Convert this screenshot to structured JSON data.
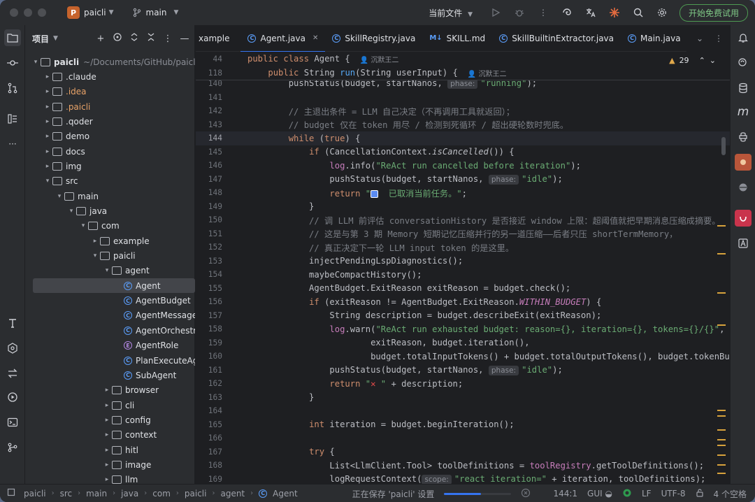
{
  "window": {
    "project_badge": "P",
    "project_name": "paicli",
    "branch": "main",
    "run_config": "当前文件",
    "trial_button": "开始免费试用"
  },
  "project_panel": {
    "title": "项目",
    "tree": [
      {
        "depth": 0,
        "arrow": "open",
        "icon": "folder",
        "name": "paicli",
        "path": "~/Documents/GitHub/paicli",
        "style": "bold"
      },
      {
        "depth": 1,
        "arrow": "closed",
        "icon": "folder",
        "name": ".claude"
      },
      {
        "depth": 1,
        "arrow": "closed",
        "icon": "folder",
        "name": ".idea",
        "style": "orange"
      },
      {
        "depth": 1,
        "arrow": "closed",
        "icon": "folder",
        "name": ".paicli",
        "style": "orange"
      },
      {
        "depth": 1,
        "arrow": "closed",
        "icon": "folder",
        "name": ".qoder"
      },
      {
        "depth": 1,
        "arrow": "closed",
        "icon": "folder",
        "name": "demo"
      },
      {
        "depth": 1,
        "arrow": "closed",
        "icon": "folder",
        "name": "docs"
      },
      {
        "depth": 1,
        "arrow": "closed",
        "icon": "folder",
        "name": "img"
      },
      {
        "depth": 1,
        "arrow": "open",
        "icon": "folder",
        "name": "src"
      },
      {
        "depth": 2,
        "arrow": "open",
        "icon": "folder",
        "name": "main"
      },
      {
        "depth": 3,
        "arrow": "open",
        "icon": "folder",
        "name": "java"
      },
      {
        "depth": 4,
        "arrow": "open",
        "icon": "folder",
        "name": "com"
      },
      {
        "depth": 5,
        "arrow": "closed",
        "icon": "folder",
        "name": "example"
      },
      {
        "depth": 5,
        "arrow": "open",
        "icon": "folder",
        "name": "paicli"
      },
      {
        "depth": 6,
        "arrow": "open",
        "icon": "folder",
        "name": "agent"
      },
      {
        "depth": 7,
        "arrow": "none",
        "icon": "class",
        "name": "Agent",
        "selected": true
      },
      {
        "depth": 7,
        "arrow": "none",
        "icon": "class",
        "name": "AgentBudget"
      },
      {
        "depth": 7,
        "arrow": "none",
        "icon": "class",
        "name": "AgentMessage"
      },
      {
        "depth": 7,
        "arrow": "none",
        "icon": "class",
        "name": "AgentOrchestr"
      },
      {
        "depth": 7,
        "arrow": "none",
        "icon": "enum",
        "name": "AgentRole"
      },
      {
        "depth": 7,
        "arrow": "none",
        "icon": "class",
        "name": "PlanExecuteAg"
      },
      {
        "depth": 7,
        "arrow": "none",
        "icon": "class",
        "name": "SubAgent"
      },
      {
        "depth": 6,
        "arrow": "closed",
        "icon": "folder",
        "name": "browser"
      },
      {
        "depth": 6,
        "arrow": "closed",
        "icon": "folder",
        "name": "cli"
      },
      {
        "depth": 6,
        "arrow": "closed",
        "icon": "folder",
        "name": "config"
      },
      {
        "depth": 6,
        "arrow": "closed",
        "icon": "folder",
        "name": "context"
      },
      {
        "depth": 6,
        "arrow": "closed",
        "icon": "folder",
        "name": "hitl"
      },
      {
        "depth": 6,
        "arrow": "closed",
        "icon": "folder",
        "name": "image"
      },
      {
        "depth": 6,
        "arrow": "closed",
        "icon": "folder",
        "name": "llm"
      }
    ]
  },
  "tabs": [
    {
      "label": "xample",
      "icon": "none"
    },
    {
      "label": "Agent.java",
      "icon": "class",
      "active": true,
      "closable": true
    },
    {
      "label": "SkillRegistry.java",
      "icon": "class"
    },
    {
      "label": "SKILL.md",
      "icon": "md"
    },
    {
      "label": "SkillBuiltinExtractor.java",
      "icon": "class"
    },
    {
      "label": "Main.java",
      "icon": "class"
    }
  ],
  "md_icon_text": "M↓",
  "inspections": {
    "warning_count": "29"
  },
  "sticky_lines": [
    {
      "ln": "44",
      "tokens": [
        [
          "kw",
          "public class "
        ],
        [
          "",
          "Agent {"
        ]
      ],
      "author": "沉默王二"
    },
    {
      "ln": "118",
      "tokens": [
        [
          "",
          "    "
        ],
        [
          "kw",
          "public "
        ],
        [
          "",
          "String "
        ],
        [
          "fn",
          "run"
        ],
        [
          "",
          "(String userInput) {"
        ]
      ],
      "author": "沉默王二"
    }
  ],
  "code_lines": [
    {
      "ln": "140",
      "tokens": [
        [
          "",
          "        pushStatus(budget, startNanos, "
        ],
        [
          "hint",
          "phase:"
        ],
        [
          "st",
          "\"running\""
        ],
        [
          "",
          ");"
        ]
      ]
    },
    {
      "ln": "141",
      "tokens": []
    },
    {
      "ln": "142",
      "tokens": [
        [
          "cm",
          "        // 主退出条件 = LLM 自己决定（不再调用工具就返回）；"
        ]
      ]
    },
    {
      "ln": "143",
      "tokens": [
        [
          "cm",
          "        // budget 仅在 token 用尽 / 检测到死循环 / 超出硬轮数时兜底。"
        ]
      ]
    },
    {
      "ln": "144",
      "current": true,
      "tokens": [
        [
          "",
          "        "
        ],
        [
          "kw",
          "while "
        ],
        [
          "",
          "("
        ],
        [
          "kw",
          "true"
        ],
        [
          "",
          ") {"
        ]
      ]
    },
    {
      "ln": "145",
      "tokens": [
        [
          "",
          "            "
        ],
        [
          "kw",
          "if "
        ],
        [
          "",
          "(CancellationContext."
        ],
        [
          "it",
          "isCancelled"
        ],
        [
          "",
          "()) {"
        ]
      ]
    },
    {
      "ln": "146",
      "tokens": [
        [
          "",
          "                "
        ],
        [
          "fi",
          "log"
        ],
        [
          "",
          ".info("
        ],
        [
          "st",
          "\"ReAct run cancelled before iteration\""
        ],
        [
          "",
          ");"
        ]
      ]
    },
    {
      "ln": "147",
      "tokens": [
        [
          "",
          "                pushStatus(budget, startNanos, "
        ],
        [
          "hint",
          "phase:"
        ],
        [
          "st",
          "\"idle\""
        ],
        [
          "",
          ");"
        ]
      ]
    },
    {
      "ln": "148",
      "tokens": [
        [
          "",
          "                "
        ],
        [
          "kw",
          "return "
        ],
        [
          "st",
          "\""
        ],
        [
          "emoji",
          ""
        ],
        [
          "st",
          "  已取消当前任务。\""
        ],
        [
          "",
          ";"
        ]
      ]
    },
    {
      "ln": "149",
      "tokens": [
        [
          "",
          "            }"
        ]
      ]
    },
    {
      "ln": "150",
      "tokens": [
        [
          "cm",
          "            // 调 LLM 前评估 conversationHistory 是否接近 window 上限：超阈值就把早期消息压缩成摘要。"
        ]
      ]
    },
    {
      "ln": "151",
      "tokens": [
        [
          "cm",
          "            // 这是与第 3 期 Memory 短期记忆压缩并行的另一道压缩——后者只压 shortTermMemory，"
        ]
      ]
    },
    {
      "ln": "152",
      "tokens": [
        [
          "cm",
          "            // 真正决定下一轮 LLM input token 的是这里。"
        ]
      ]
    },
    {
      "ln": "153",
      "tokens": [
        [
          "",
          "            injectPendingLspDiagnostics();"
        ]
      ]
    },
    {
      "ln": "154",
      "tokens": [
        [
          "",
          "            maybeCompactHistory();"
        ]
      ]
    },
    {
      "ln": "155",
      "tokens": [
        [
          "",
          "            AgentBudget.ExitReason exitReason = budget.check();"
        ]
      ]
    },
    {
      "ln": "156",
      "tokens": [
        [
          "",
          "            "
        ],
        [
          "kw",
          "if "
        ],
        [
          "",
          "(exitReason != AgentBudget.ExitReason."
        ],
        [
          "itc",
          "WITHIN_BUDGET"
        ],
        [
          "",
          ") {"
        ]
      ]
    },
    {
      "ln": "157",
      "tokens": [
        [
          "",
          "                String description = budget.describeExit(exitReason);"
        ]
      ]
    },
    {
      "ln": "158",
      "tokens": [
        [
          "",
          "                "
        ],
        [
          "fi",
          "log"
        ],
        [
          "",
          ".warn("
        ],
        [
          "st",
          "\"ReAct run exhausted budget: reason={}, iteration={}, tokens={}/{}\""
        ],
        [
          "",
          ","
        ]
      ]
    },
    {
      "ln": "159",
      "tokens": [
        [
          "",
          "                        exitReason, budget.iteration(),"
        ]
      ]
    },
    {
      "ln": "160",
      "tokens": [
        [
          "",
          "                        budget.totalInputTokens() + budget.totalOutputTokens(), budget.tokenBudget()"
        ]
      ]
    },
    {
      "ln": "161",
      "tokens": [
        [
          "",
          "                pushStatus(budget, startNanos, "
        ],
        [
          "hint",
          "phase:"
        ],
        [
          "st",
          "\"idle\""
        ],
        [
          "",
          ");"
        ]
      ]
    },
    {
      "ln": "162",
      "tokens": [
        [
          "",
          "                "
        ],
        [
          "kw",
          "return "
        ],
        [
          "st",
          "\""
        ],
        [
          "redx",
          "✕"
        ],
        [
          "st",
          " \""
        ],
        [
          "",
          " + description;"
        ]
      ]
    },
    {
      "ln": "163",
      "tokens": [
        [
          "",
          "            }"
        ]
      ]
    },
    {
      "ln": "164",
      "tokens": []
    },
    {
      "ln": "165",
      "tokens": [
        [
          "",
          "            "
        ],
        [
          "kw",
          "int "
        ],
        [
          "",
          "iteration = budget.beginIteration();"
        ]
      ]
    },
    {
      "ln": "166",
      "tokens": []
    },
    {
      "ln": "167",
      "tokens": [
        [
          "",
          "            "
        ],
        [
          "kw",
          "try "
        ],
        [
          "",
          "{"
        ]
      ]
    },
    {
      "ln": "168",
      "tokens": [
        [
          "",
          "                List<LlmClient.Tool> toolDefinitions = "
        ],
        [
          "fi",
          "toolRegistry"
        ],
        [
          "",
          ".getToolDefinitions();"
        ]
      ]
    },
    {
      "ln": "169",
      "tokens": [
        [
          "",
          "                logRequestContext("
        ],
        [
          "hint",
          "scope:"
        ],
        [
          "st",
          "\"react iteration=\""
        ],
        [
          "",
          " + iteration, toolDefinitions);"
        ]
      ]
    }
  ],
  "status_bar": {
    "breadcrumbs": [
      "paicli",
      "src",
      "main",
      "java",
      "com",
      "paicli",
      "agent",
      "Agent"
    ],
    "saving_text": "正在保存 'paicli' 设置",
    "saving_progress": 0.55,
    "position": "144:1",
    "gui": "GUI",
    "line_sep": "LF",
    "encoding": "UTF-8",
    "indent": "4 个空格"
  }
}
